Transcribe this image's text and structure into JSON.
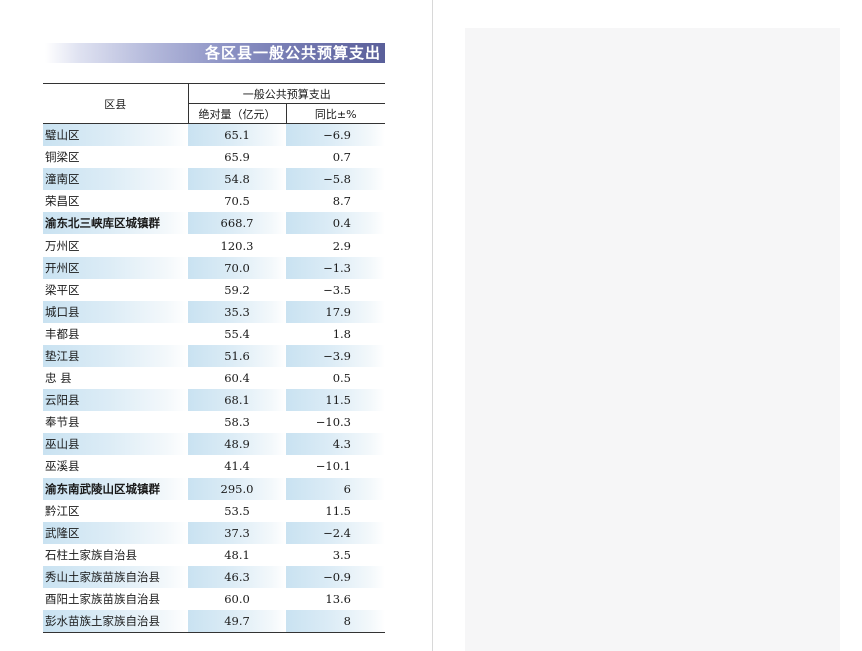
{
  "banner": {
    "title": "各区县一般公共预算支出"
  },
  "table": {
    "region_header": "区县",
    "group_header": "一般公共预算支出",
    "amount_header": "绝对量（亿元）",
    "pct_header": "同比±%",
    "rows": [
      {
        "name": "璧山区",
        "amount": "65.1",
        "pct": "−6.9",
        "shade": true,
        "bold": false
      },
      {
        "name": "铜梁区",
        "amount": "65.9",
        "pct": "0.7",
        "shade": false,
        "bold": false
      },
      {
        "name": "潼南区",
        "amount": "54.8",
        "pct": "−5.8",
        "shade": true,
        "bold": false
      },
      {
        "name": "荣昌区",
        "amount": "70.5",
        "pct": "8.7",
        "shade": false,
        "bold": false
      },
      {
        "name": "渝东北三峡库区城镇群",
        "amount": "668.7",
        "pct": "0.4",
        "shade": true,
        "bold": true
      },
      {
        "name": "万州区",
        "amount": "120.3",
        "pct": "2.9",
        "shade": false,
        "bold": false
      },
      {
        "name": "开州区",
        "amount": "70.0",
        "pct": "−1.3",
        "shade": true,
        "bold": false
      },
      {
        "name": "梁平区",
        "amount": "59.2",
        "pct": "−3.5",
        "shade": false,
        "bold": false
      },
      {
        "name": "城口县",
        "amount": "35.3",
        "pct": "17.9",
        "shade": true,
        "bold": false
      },
      {
        "name": "丰都县",
        "amount": "55.4",
        "pct": "1.8",
        "shade": false,
        "bold": false
      },
      {
        "name": "垫江县",
        "amount": "51.6",
        "pct": "−3.9",
        "shade": true,
        "bold": false
      },
      {
        "name": "忠 县",
        "amount": "60.4",
        "pct": "0.5",
        "shade": false,
        "bold": false
      },
      {
        "name": "云阳县",
        "amount": "68.1",
        "pct": "11.5",
        "shade": true,
        "bold": false
      },
      {
        "name": "奉节县",
        "amount": "58.3",
        "pct": "−10.3",
        "shade": false,
        "bold": false
      },
      {
        "name": "巫山县",
        "amount": "48.9",
        "pct": "4.3",
        "shade": true,
        "bold": false
      },
      {
        "name": "巫溪县",
        "amount": "41.4",
        "pct": "−10.1",
        "shade": false,
        "bold": false
      },
      {
        "name": "渝东南武陵山区城镇群",
        "amount": "295.0",
        "pct": "6",
        "shade": true,
        "bold": true
      },
      {
        "name": "黔江区",
        "amount": "53.5",
        "pct": "11.5",
        "shade": false,
        "bold": false
      },
      {
        "name": "武隆区",
        "amount": "37.3",
        "pct": "−2.4",
        "shade": true,
        "bold": false
      },
      {
        "name": "石柱土家族自治县",
        "amount": "48.1",
        "pct": "3.5",
        "shade": false,
        "bold": false
      },
      {
        "name": "秀山土家族苗族自治县",
        "amount": "46.3",
        "pct": "−0.9",
        "shade": true,
        "bold": false
      },
      {
        "name": "酉阳土家族苗族自治县",
        "amount": "60.0",
        "pct": "13.6",
        "shade": false,
        "bold": false
      },
      {
        "name": "彭水苗族土家族自治县",
        "amount": "49.7",
        "pct": "8",
        "shade": true,
        "bold": false
      }
    ]
  }
}
